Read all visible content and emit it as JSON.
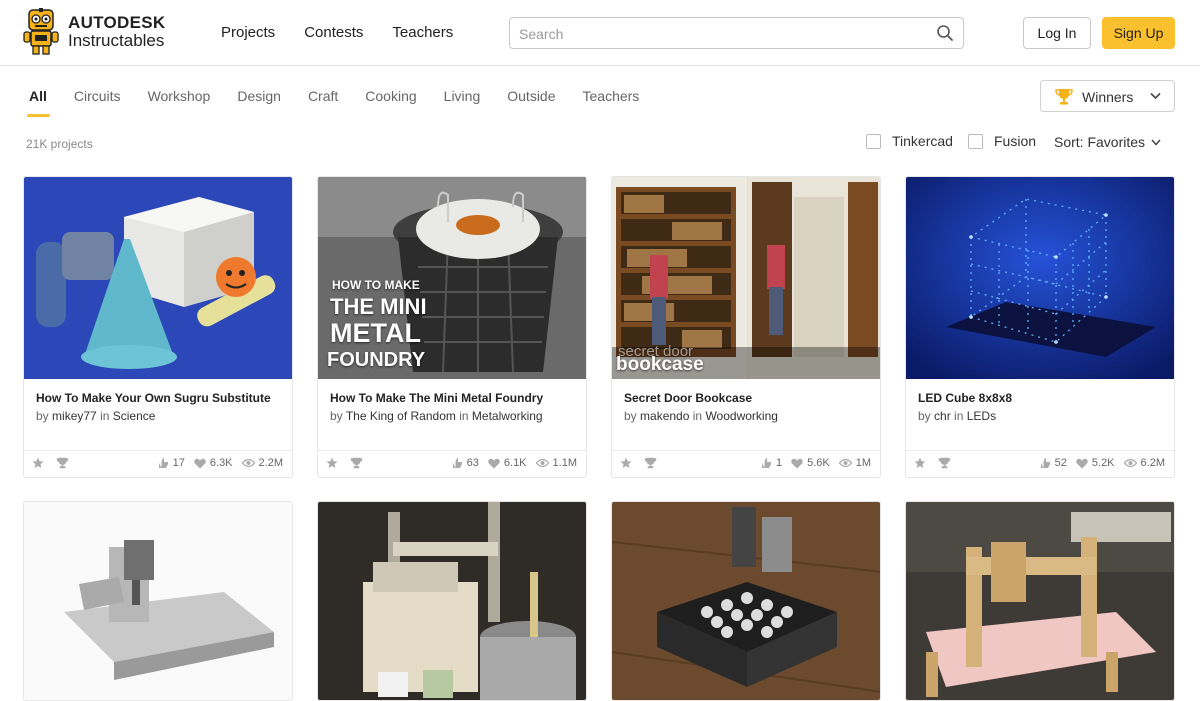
{
  "brand": {
    "line1": "AUTODESK",
    "line2": "Instructables"
  },
  "nav": [
    "Projects",
    "Contests",
    "Teachers"
  ],
  "search": {
    "placeholder": "Search",
    "value": ""
  },
  "auth": {
    "login": "Log In",
    "signup": "Sign Up"
  },
  "categories": [
    "All",
    "Circuits",
    "Workshop",
    "Design",
    "Craft",
    "Cooking",
    "Living",
    "Outside",
    "Teachers"
  ],
  "active_category": "All",
  "winners_dropdown": {
    "label": "Winners",
    "icon": "trophy-icon"
  },
  "project_count": "21K projects",
  "filters": [
    {
      "label": "Tinkercad",
      "checked": false
    },
    {
      "label": "Fusion",
      "checked": false
    }
  ],
  "sort": {
    "label": "Sort: Favorites"
  },
  "colors": {
    "accent": "#fbc02d",
    "text": "#222222",
    "muted": "#666666"
  },
  "cards": [
    {
      "title": "How To Make Your Own Sugru Substitute",
      "by": "by",
      "author": "mikey77",
      "in": "in",
      "category": "Science",
      "favorites": "17",
      "likes": "6.3K",
      "views": "2.2M"
    },
    {
      "title": "How To Make The Mini Metal Foundry",
      "by": "by",
      "author": "The King of Random",
      "in": "in",
      "category": "Metalworking",
      "favorites": "63",
      "likes": "6.1K",
      "views": "1.1M",
      "overlay": {
        "line1": "HOW TO MAKE",
        "line2": "THE MINI",
        "line3": "METAL",
        "line4": "FOUNDRY"
      }
    },
    {
      "title": "Secret Door Bookcase",
      "by": "by",
      "author": "makendo",
      "in": "in",
      "category": "Woodworking",
      "favorites": "1",
      "likes": "5.6K",
      "views": "1M",
      "overlay": {
        "line1": "secret door",
        "line2": "bookcase"
      }
    },
    {
      "title": "LED Cube 8x8x8",
      "by": "by",
      "author": "chr",
      "in": "in",
      "category": "LEDs",
      "favorites": "52",
      "likes": "5.2K",
      "views": "6.2M"
    }
  ]
}
